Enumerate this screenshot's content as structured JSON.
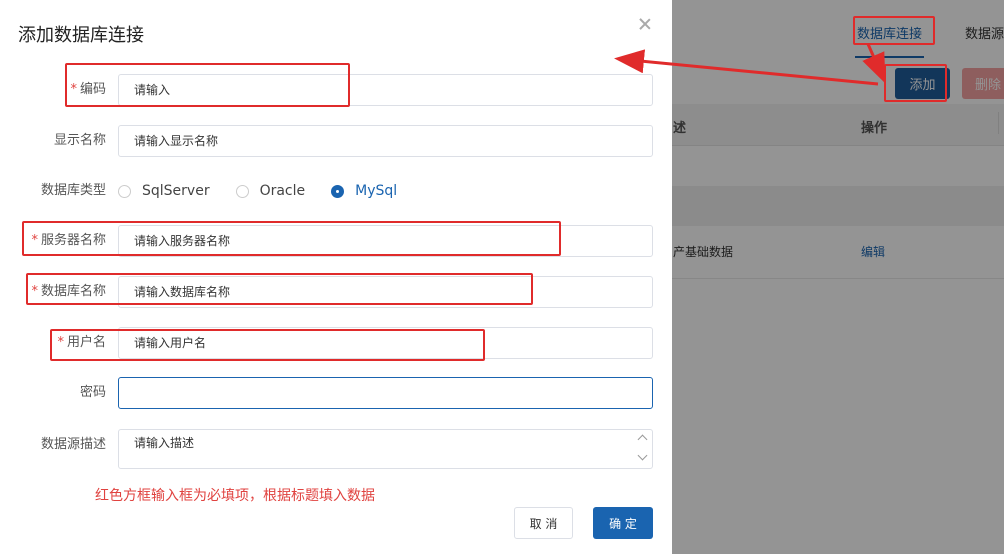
{
  "background": {
    "tabs": [
      "数据库连接",
      "数据源"
    ],
    "add_button": "添加",
    "delete_button": "删除",
    "table_headers": {
      "desc": "述",
      "operation": "操作"
    },
    "row": {
      "desc": "产基础数据",
      "action": "编辑"
    }
  },
  "dialog": {
    "title": "添加数据库连接",
    "fields": {
      "code": {
        "label": "编码",
        "placeholder": "请输入",
        "required": true
      },
      "display_name": {
        "label": "显示名称",
        "placeholder": "请输入显示名称",
        "required": false
      },
      "db_type": {
        "label": "数据库类型",
        "options": [
          "SqlServer",
          "Oracle",
          "MySql"
        ],
        "selected": "MySql"
      },
      "server_name": {
        "label": "服务器名称",
        "placeholder": "请输入服务器名称",
        "required": true
      },
      "database_name": {
        "label": "数据库名称",
        "placeholder": "请输入数据库名称",
        "required": true
      },
      "username": {
        "label": "用户名",
        "placeholder": "请输入用户名",
        "required": true
      },
      "password": {
        "label": "密码",
        "value": ""
      },
      "description": {
        "label": "数据源描述",
        "placeholder": "请输入描述"
      }
    },
    "note": "红色方框输入框为必填项，根据标题填入数据",
    "cancel": "取 消",
    "confirm": "确 定"
  },
  "colors": {
    "primary": "#1a64b0",
    "annotation_red": "#e02b2b",
    "required_star": "#e0423f"
  }
}
